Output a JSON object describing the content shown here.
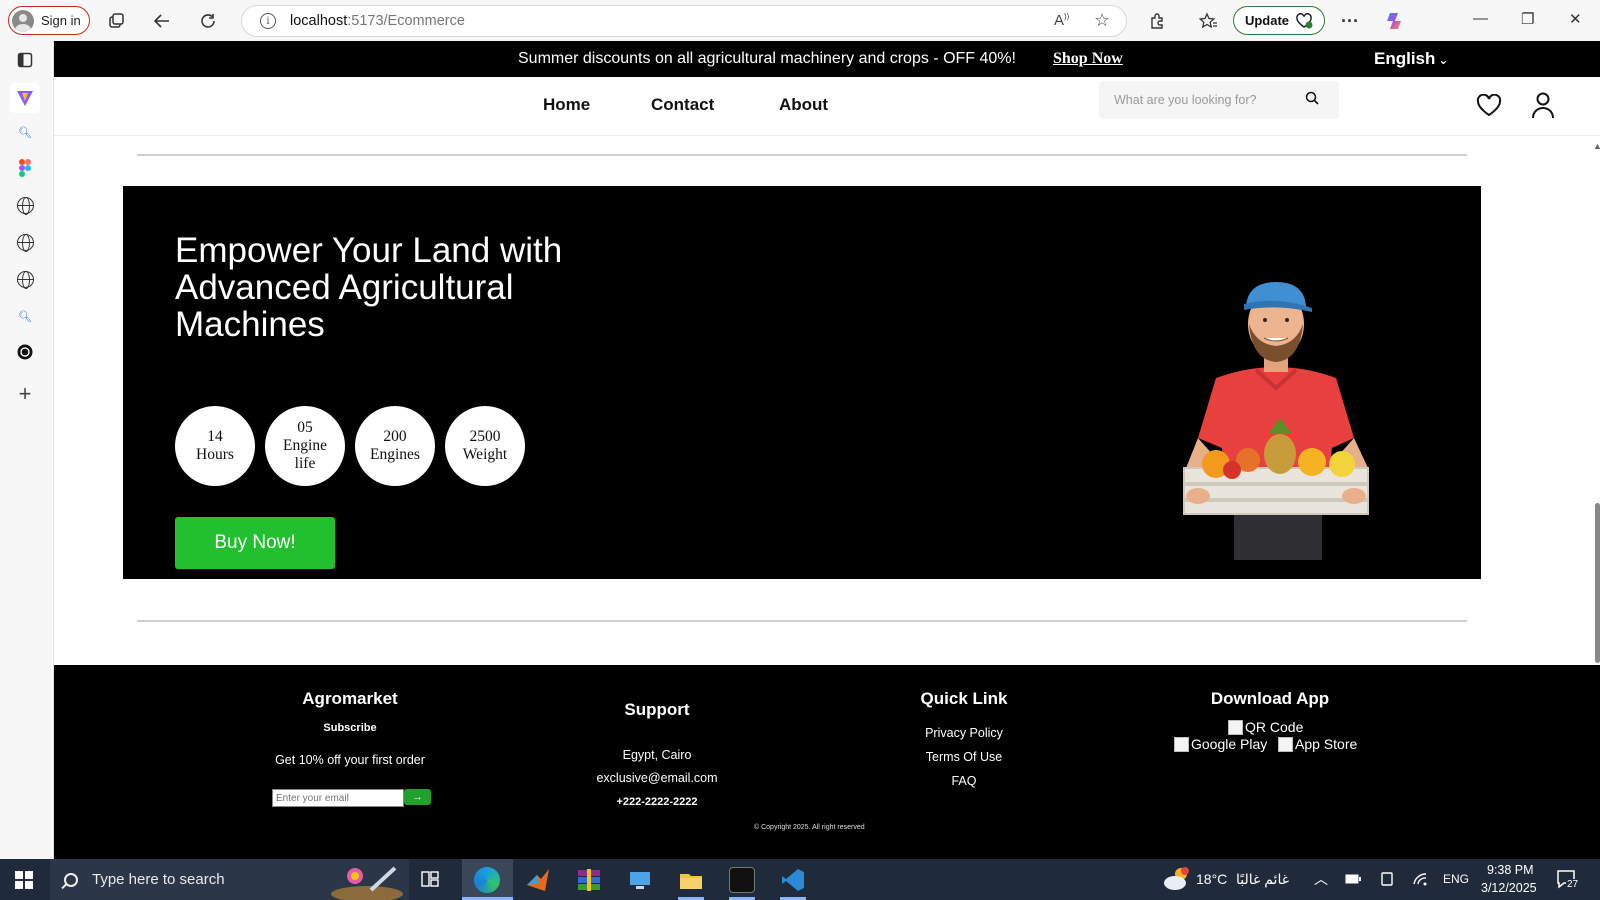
{
  "browser": {
    "sign_in": "Sign in",
    "url_host": "localhost",
    "url_path": ":5173/Ecommerce",
    "update": "Update"
  },
  "promo": {
    "text": "Summer discounts on all agricultural machinery and crops - OFF 40%!",
    "link": "Shop Now",
    "language": "English"
  },
  "nav": {
    "home": "Home",
    "contact": "Contact",
    "about": "About",
    "search_placeholder": "What are you looking for?"
  },
  "hero": {
    "title": "Empower Your Land with Advanced Agricultural Machines",
    "stats": [
      {
        "value": "14",
        "label": "Hours"
      },
      {
        "value": "05",
        "label": "Engine life"
      },
      {
        "value": "200",
        "label": "Engines"
      },
      {
        "value": "2500",
        "label": "Weight"
      }
    ],
    "cta": "Buy Now!"
  },
  "footer": {
    "brand": "Agromarket",
    "subscribe": "Subscribe",
    "offer": "Get 10% off your first order",
    "email_placeholder": "Enter your email",
    "email_button": "→",
    "support_heading": "Support",
    "address": "Egypt, Cairo",
    "email": "exclusive@email.com",
    "phone": "+222-2222-2222",
    "quick_heading": "Quick Link",
    "links": [
      "Privacy Policy",
      "Terms Of Use",
      "FAQ"
    ],
    "download_heading": "Download App",
    "qr_alt": "QR Code",
    "gplay_alt": "Google Play",
    "appstore_alt": "App Store",
    "copyright": "© Copyright 2025. All right reserved"
  },
  "taskbar": {
    "search_placeholder": "Type here to search",
    "weather": "18°C",
    "weather_text": "غائم غالبًا",
    "lang": "ENG",
    "time": "9:38 PM",
    "date": "3/12/2025",
    "notifications": "27"
  },
  "colors": {
    "accent_green": "#22c02f",
    "hero_bg": "#000000",
    "taskbar_bg": "#1f2b3a"
  }
}
